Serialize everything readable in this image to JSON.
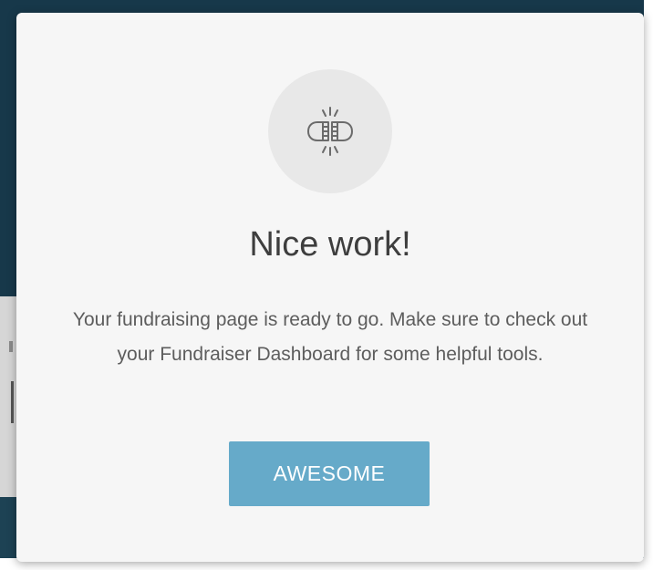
{
  "modal": {
    "icon": "fist-bump-icon",
    "title": "Nice work!",
    "message": "Your fundraising page is ready to go. Make sure to check out your Fundraiser Dashboard for some helpful tools.",
    "button_label": "AWESOME"
  },
  "colors": {
    "button": "#66aac9",
    "modal_background": "#f6f6f6",
    "backdrop": "#17384a"
  }
}
